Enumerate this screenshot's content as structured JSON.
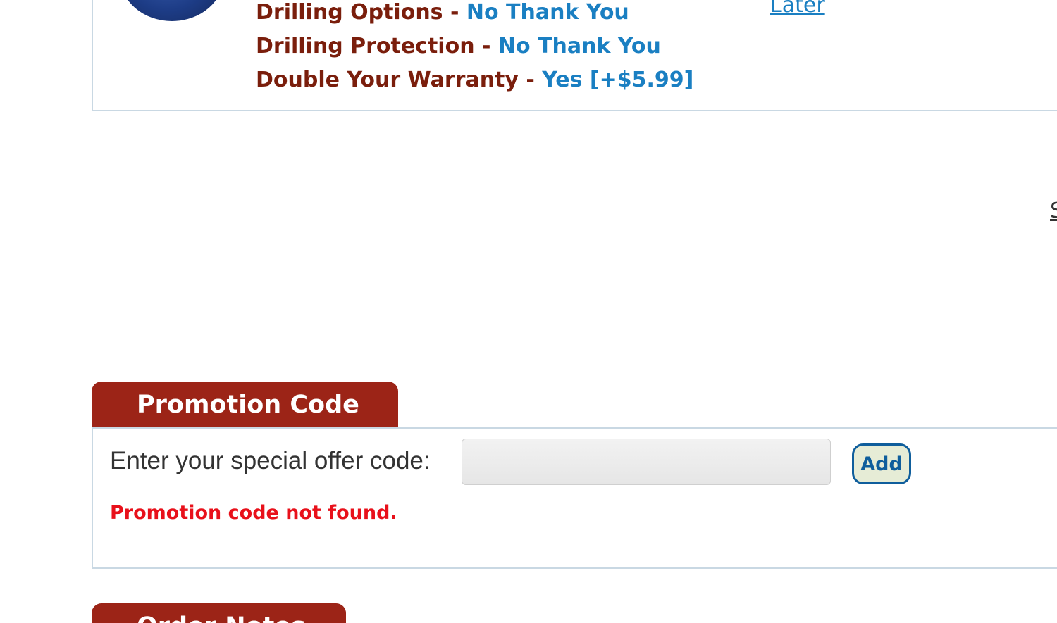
{
  "cart_item": {
    "options": [
      {
        "label": "Drilling Options - ",
        "value": "No Thank You"
      },
      {
        "label": "Drilling Protection - ",
        "value": "No Thank You"
      },
      {
        "label": "Double Your Warranty - ",
        "value": "Yes [+$5.99]"
      }
    ],
    "later_link": "Later"
  },
  "edge_glyph": "S",
  "promotion": {
    "tab_title": "Promotion Code",
    "label": "Enter your special offer code:",
    "input_value": "",
    "input_placeholder": "",
    "add_button": "Add",
    "error_message": "Promotion code not found."
  },
  "order_notes": {
    "tab_title": "Order Notes"
  },
  "colors": {
    "tab_bg": "#9c2417",
    "option_label": "#7a1e0c",
    "option_value": "#1a7fc2",
    "error": "#e8101a",
    "button_border": "#0f5e9c",
    "panel_border": "#c9d8e3"
  }
}
